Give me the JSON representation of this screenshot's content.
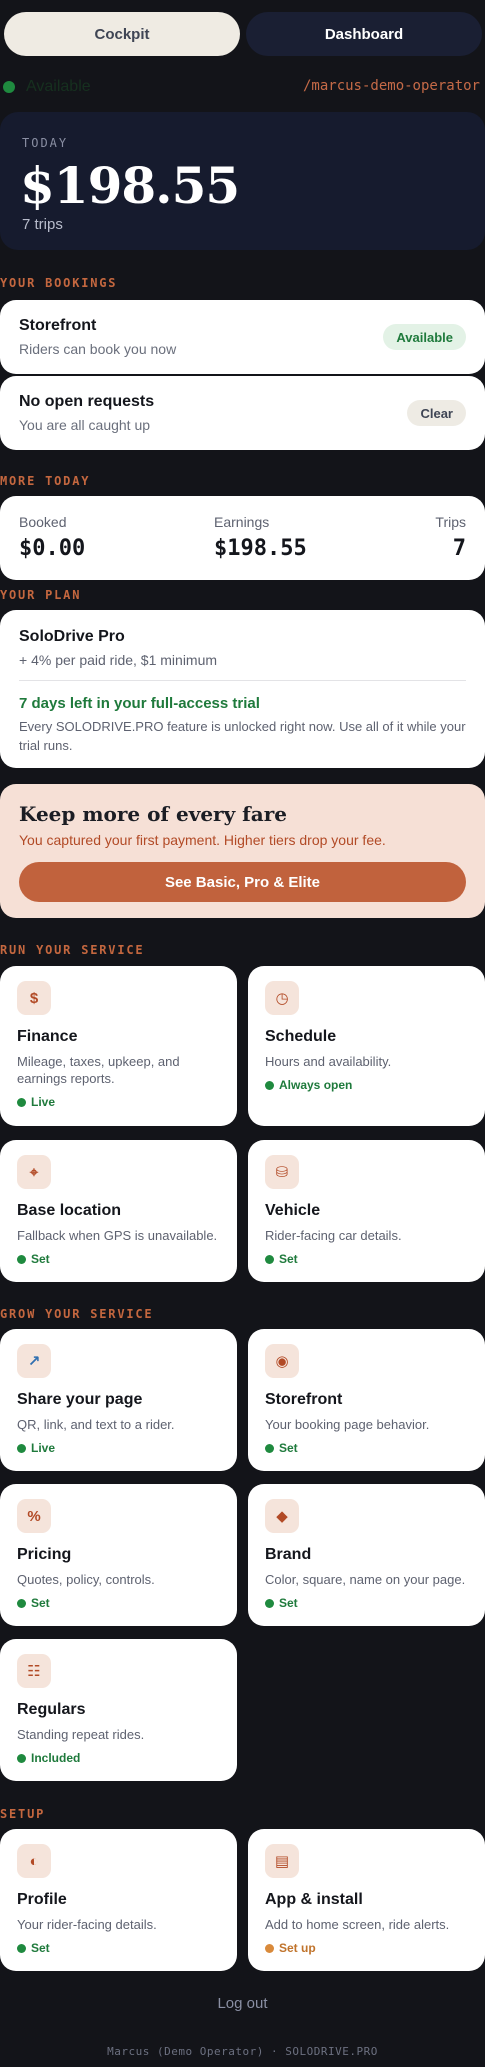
{
  "tabs": {
    "cockpit": "Cockpit",
    "dashboard": "Dashboard"
  },
  "status": {
    "label": "Available",
    "operator_path": "/marcus-demo-operator"
  },
  "today": {
    "label": "TODAY",
    "amount": "$198.55",
    "trips": "7 trips"
  },
  "bookings": {
    "section": "YOUR BOOKINGS",
    "storefront": {
      "title": "Storefront",
      "subtitle": "Riders can book you now",
      "badge": "Available"
    },
    "requests": {
      "title": "No open requests",
      "subtitle": "You are all caught up",
      "badge": "Clear"
    }
  },
  "more_today": {
    "section": "MORE TODAY",
    "booked": {
      "label": "Booked",
      "value": "$0.00"
    },
    "earnings": {
      "label": "Earnings",
      "value": "$198.55"
    },
    "trips": {
      "label": "Trips",
      "value": "7"
    }
  },
  "plan": {
    "section": "YOUR PLAN",
    "name": "SoloDrive Pro",
    "fee": "+ 4% per paid ride, $1 minimum",
    "trial_title": "7 days left in your full-access trial",
    "trial_text": "Every SOLODRIVE.PRO feature is unlocked right now. Use all of it while your trial runs."
  },
  "upsell": {
    "title": "Keep more of every fare",
    "text": "You captured your first payment. Higher tiers drop your fee.",
    "button": "See Basic, Pro & Elite"
  },
  "run_service": {
    "section": "RUN YOUR SERVICE",
    "tiles": [
      {
        "icon": "dollar-icon",
        "glyph": "$",
        "title": "Finance",
        "desc": "Mileage, taxes, upkeep, and earnings reports.",
        "status": "Live",
        "status_color": "#1f8a3f"
      },
      {
        "icon": "clock-icon",
        "glyph": "◷",
        "title": "Schedule",
        "desc": "Hours and availability.",
        "status": "Always open",
        "status_color": "#1f8a3f"
      },
      {
        "icon": "crosshair-icon",
        "glyph": "⌖",
        "title": "Base location",
        "desc": "Fallback when GPS is unavailable.",
        "status": "Set",
        "status_color": "#1f8a3f"
      },
      {
        "icon": "database-icon",
        "glyph": "⛁",
        "title": "Vehicle",
        "desc": "Rider-facing car details.",
        "status": "Set",
        "status_color": "#1f8a3f"
      }
    ]
  },
  "grow_service": {
    "section": "GROW YOUR SERVICE",
    "tiles": [
      {
        "icon": "share-arrow-icon",
        "glyph": "↗",
        "title": "Share your page",
        "desc": "QR, link, and text to a rider.",
        "status": "Live",
        "status_color": "#1f8a3f"
      },
      {
        "icon": "target-icon",
        "glyph": "◉",
        "title": "Storefront",
        "desc": "Your booking page behavior.",
        "status": "Set",
        "status_color": "#1f8a3f"
      },
      {
        "icon": "percent-icon",
        "glyph": "%",
        "title": "Pricing",
        "desc": "Quotes, policy, controls.",
        "status": "Set",
        "status_color": "#1f8a3f"
      },
      {
        "icon": "diamond-icon",
        "glyph": "◆",
        "title": "Brand",
        "desc": "Color, square, name on your page.",
        "status": "Set",
        "status_color": "#1f8a3f"
      },
      {
        "icon": "list-icon",
        "glyph": "☷",
        "title": "Regulars",
        "desc": "Standing repeat rides.",
        "status": "Included",
        "status_color": "#1f8a3f"
      }
    ]
  },
  "setup": {
    "section": "SETUP",
    "tiles": [
      {
        "icon": "half-circle-icon",
        "glyph": "◐",
        "title": "Profile",
        "desc": "Your rider-facing details.",
        "status": "Set",
        "status_color": "#1f8a3f"
      },
      {
        "icon": "app-window-icon",
        "glyph": "▤",
        "title": "App & install",
        "desc": "Add to home screen, ride alerts.",
        "status": "Set up",
        "status_color": "#d98a3b"
      }
    ]
  },
  "logout": "Log out",
  "footer": "Marcus (Demo Operator) · SOLODRIVE.PRO",
  "colors": {
    "accent": "#c1623d",
    "page_bg": "#131419",
    "card_dark": "#161b2e",
    "success": "#1f8a3f"
  }
}
